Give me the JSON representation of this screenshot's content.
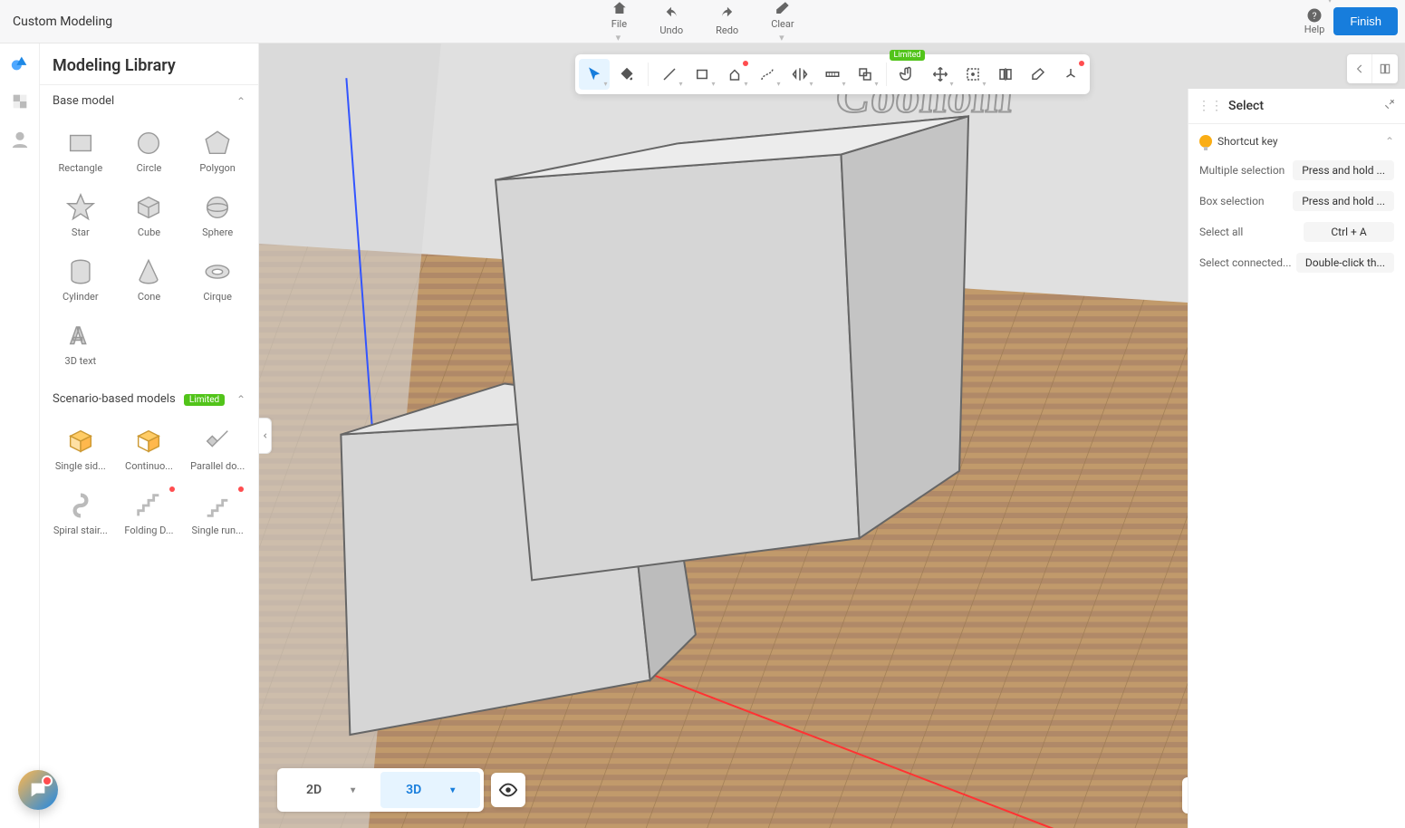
{
  "app_title": "Custom Modeling",
  "topbar": {
    "file": "File",
    "undo": "Undo",
    "redo": "Redo",
    "clear": "Clear",
    "help": "Help",
    "finish": "Finish"
  },
  "library": {
    "title": "Modeling Library",
    "base_model_header": "Base model",
    "items": [
      {
        "id": "rectangle",
        "label": "Rectangle"
      },
      {
        "id": "circle",
        "label": "Circle"
      },
      {
        "id": "polygon",
        "label": "Polygon"
      },
      {
        "id": "star",
        "label": "Star"
      },
      {
        "id": "cube",
        "label": "Cube"
      },
      {
        "id": "sphere",
        "label": "Sphere"
      },
      {
        "id": "cylinder",
        "label": "Cylinder"
      },
      {
        "id": "cone",
        "label": "Cone"
      },
      {
        "id": "cirque",
        "label": "Cirque"
      },
      {
        "id": "text3d",
        "label": "3D text"
      }
    ],
    "scenario_header": "Scenario-based models",
    "scenario_badge": "Limited",
    "scenario_items": [
      {
        "id": "single-sided",
        "label": "Single sid..."
      },
      {
        "id": "continuous",
        "label": "Continuo..."
      },
      {
        "id": "parallel-door",
        "label": "Parallel do..."
      },
      {
        "id": "spiral-stair",
        "label": "Spiral stair..."
      },
      {
        "id": "folding-door",
        "label": "Folding D...",
        "dot": true
      },
      {
        "id": "single-run",
        "label": "Single run...",
        "dot": true
      }
    ]
  },
  "float_tools": {
    "limited_badge": "Limited"
  },
  "view_toggle": {
    "two_d": "2D",
    "three_d": "3D"
  },
  "scene_logo": "Coohom",
  "props": {
    "title": "Select",
    "section": "Shortcut key",
    "rows": [
      {
        "k": "Multiple selection",
        "v": "Press and hold ..."
      },
      {
        "k": "Box selection",
        "v": "Press and hold ..."
      },
      {
        "k": "Select all",
        "v": "Ctrl + A"
      },
      {
        "k": "Select connected...",
        "v": "Double-click th..."
      }
    ]
  }
}
